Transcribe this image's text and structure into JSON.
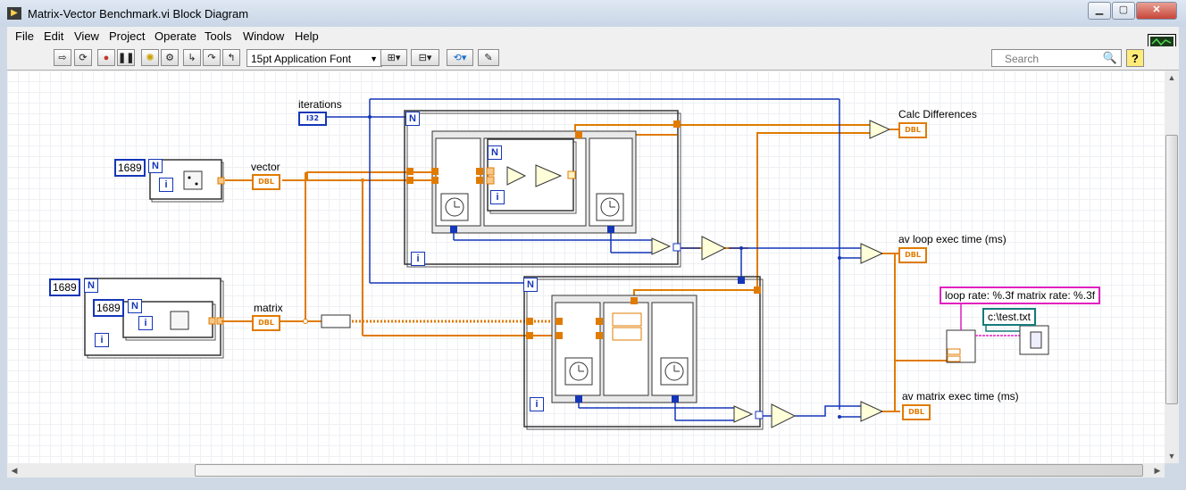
{
  "window": {
    "title": "Matrix-Vector Benchmark.vi Block Diagram"
  },
  "menu": [
    "File",
    "Edit",
    "View",
    "Project",
    "Operate",
    "Tools",
    "Window",
    "Help"
  ],
  "toolbar": {
    "font": "15pt Application Font",
    "search_placeholder": "Search",
    "help": "?"
  },
  "diagram": {
    "labels": {
      "iterations": "iterations",
      "vector": "vector",
      "matrix": "matrix",
      "calc_differences": "Calc Differences",
      "av_loop": "av loop exec time (ms)",
      "av_matrix": "av matrix exec time (ms)"
    },
    "constants": {
      "vector_size": "1689",
      "matrix_rows": "1689",
      "matrix_cols": "1689"
    },
    "format_string": "loop rate: %.3f   matrix rate: %.3f",
    "file_path": "c:\\test.txt",
    "type_dbl": "DBL",
    "type_i32": "I32",
    "loop_count": "N",
    "loop_index": "i"
  }
}
